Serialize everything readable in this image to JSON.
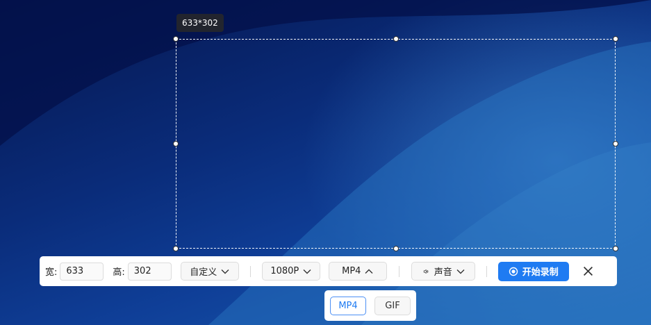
{
  "size_tip": "633*302",
  "toolbar": {
    "width_label": "宽:",
    "width_value": "633",
    "height_label": "高:",
    "height_value": "302",
    "aspect_dropdown": "自定义",
    "resolution_dropdown": "1080P",
    "format_dropdown": "MP4",
    "sound_dropdown": "声音",
    "record_button": "开始录制",
    "close_icon": "close-icon"
  },
  "format_menu": {
    "options": [
      "MP4",
      "GIF"
    ],
    "selected": "MP4"
  },
  "colors": {
    "accent": "#1f7bf2",
    "toolbar_bg": "#ffffff",
    "tooltip_bg": "#282828"
  }
}
